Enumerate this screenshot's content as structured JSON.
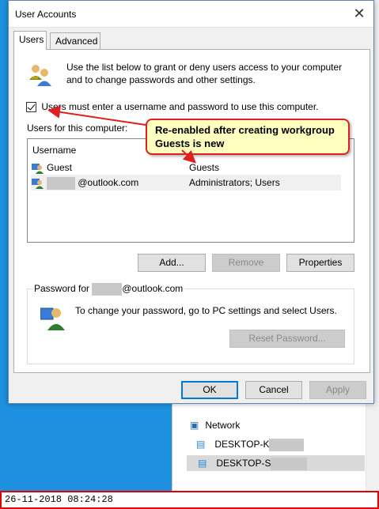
{
  "window": {
    "title": "User Accounts"
  },
  "tabs": [
    {
      "label": "Users",
      "active": true
    },
    {
      "label": "Advanced",
      "active": false
    }
  ],
  "intro": "Use the list below to grant or deny users access to your computer and to change passwords and other settings.",
  "require_login": {
    "checked": true,
    "label": "Users must enter a username and password to use this computer."
  },
  "users_label": "Users for this computer:",
  "list": {
    "column_username": "Username",
    "rows": [
      {
        "name": "Guest",
        "group": "Guests"
      },
      {
        "name": "@outlook.com",
        "group": "Administrators; Users"
      }
    ]
  },
  "buttons": {
    "add": "Add...",
    "remove": "Remove",
    "properties": "Properties",
    "reset_password": "Reset Password...",
    "ok": "OK",
    "cancel": "Cancel",
    "apply": "Apply"
  },
  "password": {
    "legend_prefix": "Password for",
    "legend_suffix": "@outlook.com",
    "text": "To change your password, go to PC settings and select Users."
  },
  "callout": "Re-enabled after creating workgroup Guests is new",
  "explorer": {
    "network_label": "Network",
    "items": [
      "DESKTOP-K",
      "DESKTOP-S"
    ]
  },
  "timestamp": "26-11-2018 08:24:28",
  "colors": {
    "callout_border": "#e02020",
    "callout_fill": "#ffffc0",
    "accent": "#0078d7"
  }
}
